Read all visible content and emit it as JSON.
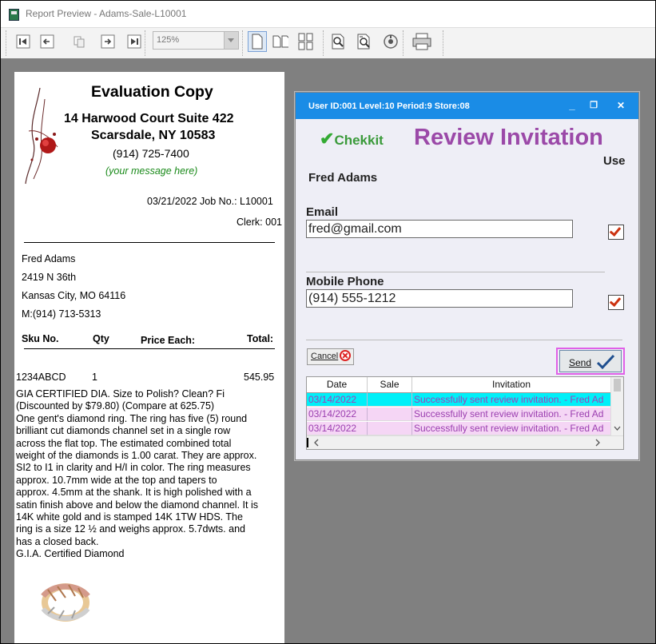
{
  "window": {
    "title": "Report Preview - Adams-Sale-L10001"
  },
  "toolbar": {
    "zoom_value": "125%",
    "buttons": [
      "first-page-icon",
      "prev-page-icon",
      "copy-icon",
      "next-page-icon",
      "last-page-icon",
      "single-page-icon",
      "two-page-icon",
      "multi-page-icon",
      "zoom-in-icon",
      "zoom-out-icon",
      "record-icon",
      "print-icon"
    ]
  },
  "report": {
    "header_title": "Evaluation Copy",
    "address1": "14 Harwood Court Suite 422",
    "address2": "Scarsdale, NY 10583",
    "phone": "(914) 725-7400",
    "message": "(your message here)",
    "date_job": "03/21/2022  Job No.: L10001",
    "clerk": "Clerk: 001",
    "customer": {
      "name": "Fred Adams",
      "street": "2419 N 36th",
      "city": "Kansas City, MO  64116",
      "mobile": "M:(914) 713-5313"
    },
    "columns": {
      "sku": "Sku No.",
      "qty": "Qty",
      "price": "Price Each:",
      "total": "Total:"
    },
    "line": {
      "sku": "1234ABCD",
      "qty": "1",
      "total": "545.95"
    },
    "description": [
      "GIA CERTIFIED DIA. Size to Polish? Clean? Fi",
      "(Discounted by $79.80) (Compare at 625.75)",
      "One gent's diamond ring. The ring has five (5) round",
      "brilliant cut diamonds channel set in a single row",
      "across the flat top. The estimated combined total",
      "weight of the diamonds is 1.00 carat. They are approx.",
      "SI2 to I1 in clarity and H/I in color. The ring measures",
      "approx. 10.7mm wide at the top and tapers to",
      "approx. 4.5mm at the shank. It is high polished with a",
      "satin finish above and below the diamond channel. It is",
      "14K white gold and is stamped 14K 1TW HDS. The",
      "ring is a size 12 ½ and weighs approx. 5.7dwts. and",
      "has a closed back.",
      "G.I.A. Certified Diamond"
    ]
  },
  "dialog": {
    "title": "User ID:001 Level:10 Period:9 Store:08",
    "controls": {
      "minimize": "_",
      "restore": "❐",
      "close": "✕"
    },
    "brand": "Chekkit",
    "brand_mark": "✔",
    "heading": "Review Invitation",
    "use_label": "Use",
    "customer_name": "Fred Adams",
    "email_label": "Email",
    "email_value": "fred@gmail.com",
    "email_use_checked": true,
    "phone_label": "Mobile Phone",
    "phone_value": "(914) 555-1212",
    "phone_use_checked": true,
    "cancel_label": "Cancel",
    "send_label": "Send",
    "grid": {
      "columns": [
        "Date",
        "Sale",
        "Invitation"
      ],
      "rows": [
        {
          "date": "03/14/2022",
          "sale": "",
          "invitation": "Successfully sent review invitation. - Fred Ad",
          "selected": true
        },
        {
          "date": "03/14/2022",
          "sale": "",
          "invitation": "Successfully sent review invitation. - Fred Ad",
          "selected": false
        },
        {
          "date": "03/14/2022",
          "sale": "",
          "invitation": "Successfully sent review invitation. - Fred Ad",
          "selected": false
        }
      ]
    }
  }
}
